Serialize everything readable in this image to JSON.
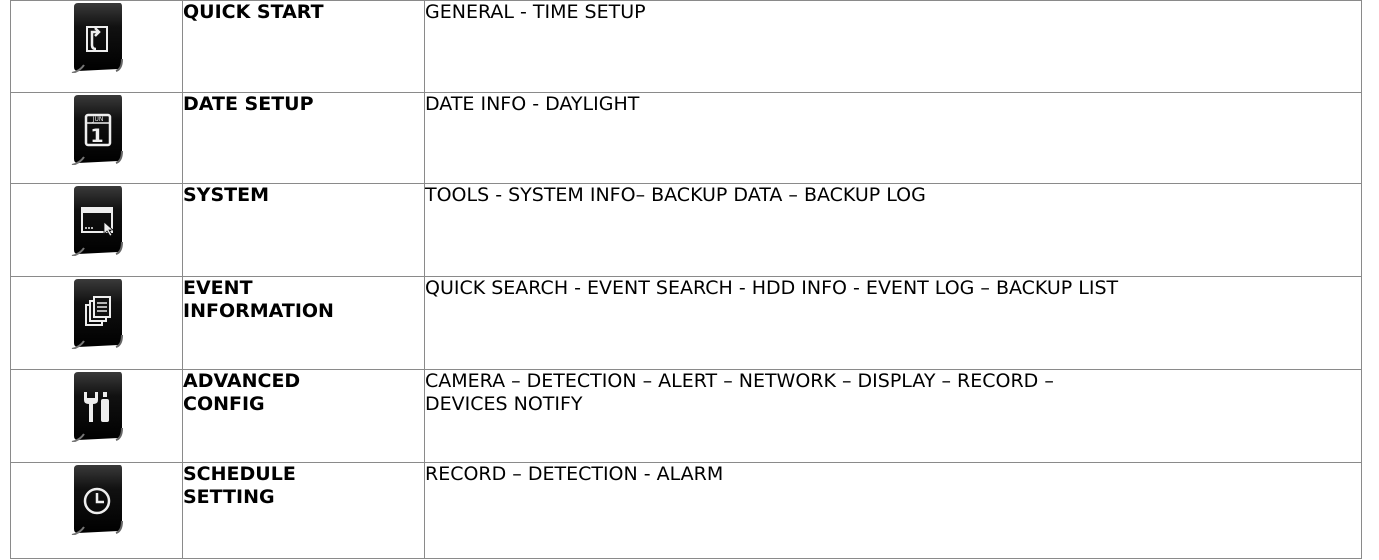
{
  "rows": [
    {
      "icon": "quick-start-icon",
      "name": "QUICK START",
      "description": "GENERAL - TIME SETUP"
    },
    {
      "icon": "calendar-icon",
      "icon_text": "JUN",
      "icon_digit": "1",
      "name": "DATE SETUP",
      "description": "DATE INFO - DAYLIGHT"
    },
    {
      "icon": "system-window-icon",
      "name": "SYSTEM",
      "description": "TOOLS - SYSTEM INFO– BACKUP DATA – BACKUP LOG"
    },
    {
      "icon": "documents-icon",
      "name": "EVENT\nINFORMATION",
      "description": "QUICK SEARCH - EVENT SEARCH - HDD INFO - EVENT LOG – BACKUP LIST"
    },
    {
      "icon": "tools-icon",
      "name": "ADVANCED\nCONFIG",
      "description": "CAMERA – DETECTION – ALERT – NETWORK – DISPLAY – RECORD –\nDEVICES NOTIFY"
    },
    {
      "icon": "clock-icon",
      "name": "SCHEDULE\nSETTING",
      "description": "RECORD – DETECTION - ALARM"
    }
  ],
  "colors": {
    "icon_background": "#0d0d0d",
    "icon_foreground": "#f2f2f2",
    "border": "#8a8a8a"
  }
}
